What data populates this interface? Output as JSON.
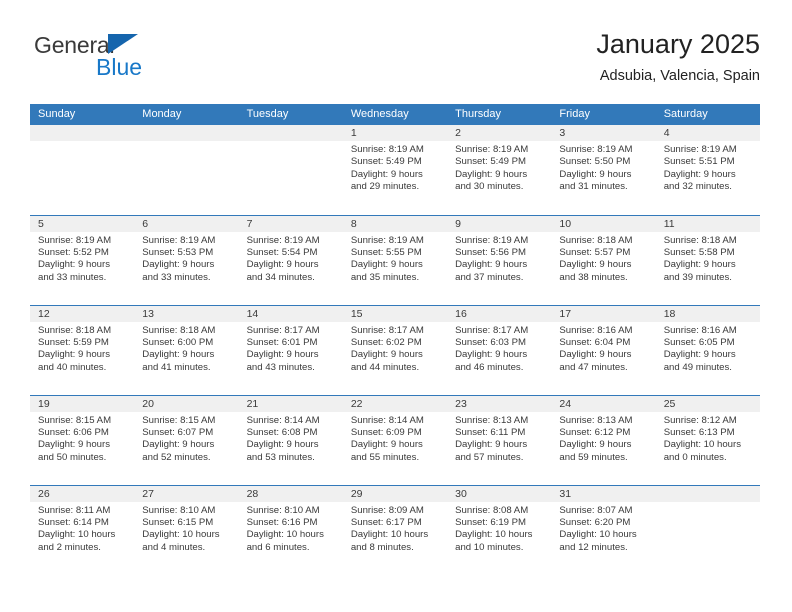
{
  "brand": {
    "name_top": "General",
    "name_bottom": "Blue",
    "triangle_icon": "blue-triangle-icon"
  },
  "header": {
    "title": "January 2025",
    "subtitle": "Adsubia, Valencia, Spain"
  },
  "colors": {
    "header_blue": "#3279ba",
    "brand_blue": "#1878c8",
    "brand_dark": "#3a3a3a",
    "day_band_gray": "#f0f0f0",
    "text": "#3a3a3a"
  },
  "weekday_headers": [
    "Sunday",
    "Monday",
    "Tuesday",
    "Wednesday",
    "Thursday",
    "Friday",
    "Saturday"
  ],
  "weeks": [
    [
      {
        "day": "",
        "lines": []
      },
      {
        "day": "",
        "lines": []
      },
      {
        "day": "",
        "lines": []
      },
      {
        "day": "1",
        "lines": [
          "Sunrise: 8:19 AM",
          "Sunset: 5:49 PM",
          "Daylight: 9 hours",
          "and 29 minutes."
        ]
      },
      {
        "day": "2",
        "lines": [
          "Sunrise: 8:19 AM",
          "Sunset: 5:49 PM",
          "Daylight: 9 hours",
          "and 30 minutes."
        ]
      },
      {
        "day": "3",
        "lines": [
          "Sunrise: 8:19 AM",
          "Sunset: 5:50 PM",
          "Daylight: 9 hours",
          "and 31 minutes."
        ]
      },
      {
        "day": "4",
        "lines": [
          "Sunrise: 8:19 AM",
          "Sunset: 5:51 PM",
          "Daylight: 9 hours",
          "and 32 minutes."
        ]
      }
    ],
    [
      {
        "day": "5",
        "lines": [
          "Sunrise: 8:19 AM",
          "Sunset: 5:52 PM",
          "Daylight: 9 hours",
          "and 33 minutes."
        ]
      },
      {
        "day": "6",
        "lines": [
          "Sunrise: 8:19 AM",
          "Sunset: 5:53 PM",
          "Daylight: 9 hours",
          "and 33 minutes."
        ]
      },
      {
        "day": "7",
        "lines": [
          "Sunrise: 8:19 AM",
          "Sunset: 5:54 PM",
          "Daylight: 9 hours",
          "and 34 minutes."
        ]
      },
      {
        "day": "8",
        "lines": [
          "Sunrise: 8:19 AM",
          "Sunset: 5:55 PM",
          "Daylight: 9 hours",
          "and 35 minutes."
        ]
      },
      {
        "day": "9",
        "lines": [
          "Sunrise: 8:19 AM",
          "Sunset: 5:56 PM",
          "Daylight: 9 hours",
          "and 37 minutes."
        ]
      },
      {
        "day": "10",
        "lines": [
          "Sunrise: 8:18 AM",
          "Sunset: 5:57 PM",
          "Daylight: 9 hours",
          "and 38 minutes."
        ]
      },
      {
        "day": "11",
        "lines": [
          "Sunrise: 8:18 AM",
          "Sunset: 5:58 PM",
          "Daylight: 9 hours",
          "and 39 minutes."
        ]
      }
    ],
    [
      {
        "day": "12",
        "lines": [
          "Sunrise: 8:18 AM",
          "Sunset: 5:59 PM",
          "Daylight: 9 hours",
          "and 40 minutes."
        ]
      },
      {
        "day": "13",
        "lines": [
          "Sunrise: 8:18 AM",
          "Sunset: 6:00 PM",
          "Daylight: 9 hours",
          "and 41 minutes."
        ]
      },
      {
        "day": "14",
        "lines": [
          "Sunrise: 8:17 AM",
          "Sunset: 6:01 PM",
          "Daylight: 9 hours",
          "and 43 minutes."
        ]
      },
      {
        "day": "15",
        "lines": [
          "Sunrise: 8:17 AM",
          "Sunset: 6:02 PM",
          "Daylight: 9 hours",
          "and 44 minutes."
        ]
      },
      {
        "day": "16",
        "lines": [
          "Sunrise: 8:17 AM",
          "Sunset: 6:03 PM",
          "Daylight: 9 hours",
          "and 46 minutes."
        ]
      },
      {
        "day": "17",
        "lines": [
          "Sunrise: 8:16 AM",
          "Sunset: 6:04 PM",
          "Daylight: 9 hours",
          "and 47 minutes."
        ]
      },
      {
        "day": "18",
        "lines": [
          "Sunrise: 8:16 AM",
          "Sunset: 6:05 PM",
          "Daylight: 9 hours",
          "and 49 minutes."
        ]
      }
    ],
    [
      {
        "day": "19",
        "lines": [
          "Sunrise: 8:15 AM",
          "Sunset: 6:06 PM",
          "Daylight: 9 hours",
          "and 50 minutes."
        ]
      },
      {
        "day": "20",
        "lines": [
          "Sunrise: 8:15 AM",
          "Sunset: 6:07 PM",
          "Daylight: 9 hours",
          "and 52 minutes."
        ]
      },
      {
        "day": "21",
        "lines": [
          "Sunrise: 8:14 AM",
          "Sunset: 6:08 PM",
          "Daylight: 9 hours",
          "and 53 minutes."
        ]
      },
      {
        "day": "22",
        "lines": [
          "Sunrise: 8:14 AM",
          "Sunset: 6:09 PM",
          "Daylight: 9 hours",
          "and 55 minutes."
        ]
      },
      {
        "day": "23",
        "lines": [
          "Sunrise: 8:13 AM",
          "Sunset: 6:11 PM",
          "Daylight: 9 hours",
          "and 57 minutes."
        ]
      },
      {
        "day": "24",
        "lines": [
          "Sunrise: 8:13 AM",
          "Sunset: 6:12 PM",
          "Daylight: 9 hours",
          "and 59 minutes."
        ]
      },
      {
        "day": "25",
        "lines": [
          "Sunrise: 8:12 AM",
          "Sunset: 6:13 PM",
          "Daylight: 10 hours",
          "and 0 minutes."
        ]
      }
    ],
    [
      {
        "day": "26",
        "lines": [
          "Sunrise: 8:11 AM",
          "Sunset: 6:14 PM",
          "Daylight: 10 hours",
          "and 2 minutes."
        ]
      },
      {
        "day": "27",
        "lines": [
          "Sunrise: 8:10 AM",
          "Sunset: 6:15 PM",
          "Daylight: 10 hours",
          "and 4 minutes."
        ]
      },
      {
        "day": "28",
        "lines": [
          "Sunrise: 8:10 AM",
          "Sunset: 6:16 PM",
          "Daylight: 10 hours",
          "and 6 minutes."
        ]
      },
      {
        "day": "29",
        "lines": [
          "Sunrise: 8:09 AM",
          "Sunset: 6:17 PM",
          "Daylight: 10 hours",
          "and 8 minutes."
        ]
      },
      {
        "day": "30",
        "lines": [
          "Sunrise: 8:08 AM",
          "Sunset: 6:19 PM",
          "Daylight: 10 hours",
          "and 10 minutes."
        ]
      },
      {
        "day": "31",
        "lines": [
          "Sunrise: 8:07 AM",
          "Sunset: 6:20 PM",
          "Daylight: 10 hours",
          "and 12 minutes."
        ]
      },
      {
        "day": "",
        "lines": []
      }
    ]
  ]
}
